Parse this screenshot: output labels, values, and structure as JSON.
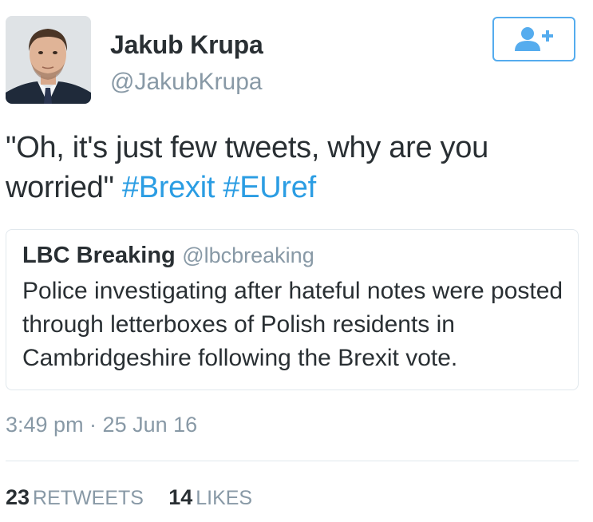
{
  "author": {
    "name": "Jakub Krupa",
    "handle": "@JakubKrupa",
    "avatar_icon": "profile-photo"
  },
  "follow_button": {
    "icon": "follow-user-plus-icon",
    "color": "#55acee"
  },
  "tweet": {
    "text": "\"Oh, it's just few tweets, why are you worried\"",
    "hashtags": [
      "#Brexit",
      "#EUref"
    ]
  },
  "quote": {
    "name": "LBC Breaking",
    "handle": "@lbcbreaking",
    "text": "Police investigating after hateful notes were posted through letterboxes of Polish residents in Cambridgeshire following the Brexit vote."
  },
  "timestamp": "3:49 pm · 25 Jun 16",
  "stats": {
    "retweets_count": "23",
    "retweets_label": "RETWEETS",
    "likes_count": "14",
    "likes_label": "LIKES"
  },
  "colors": {
    "text": "#292f33",
    "muted": "#8899a6",
    "link": "#2b9de3",
    "border": "#e1e8ed"
  }
}
